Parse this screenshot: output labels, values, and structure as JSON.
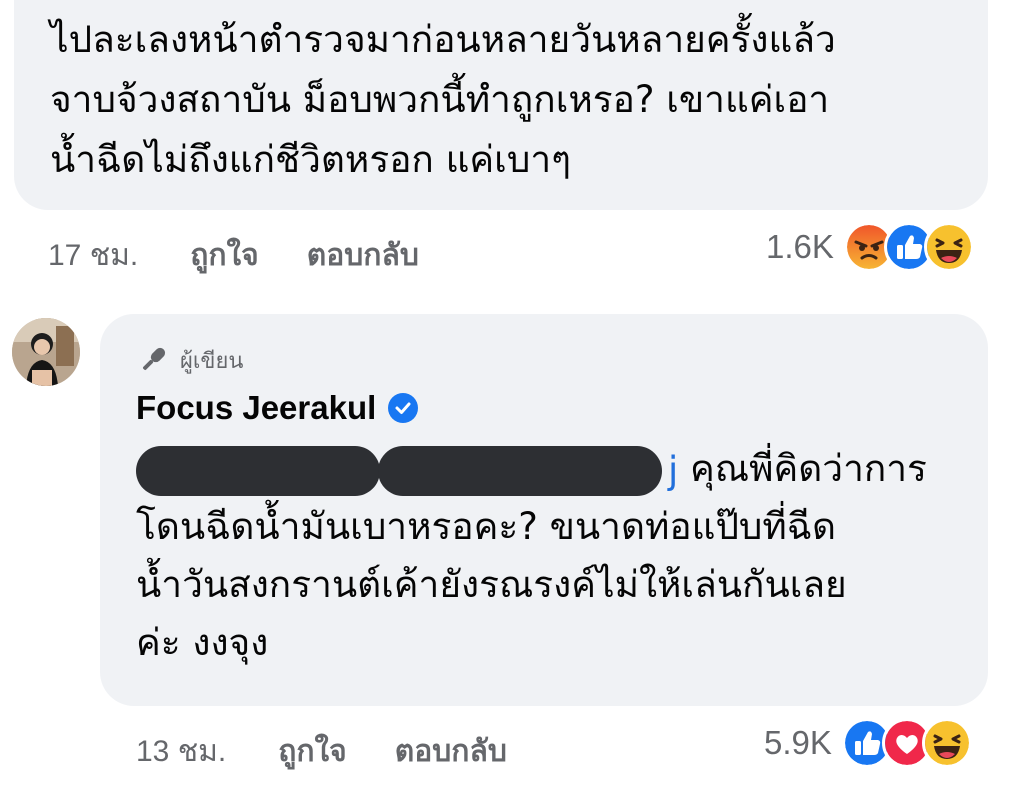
{
  "comment_1": {
    "text": "ไปละเลงหน้าตำรวจมาก่อนหลายวันหลายครั้งแล้ว\nจาบจ้วงสถาบัน ม็อบพวกนี้ทำถูกเหรอ? เขาแค่เอา\nน้ำฉีดไม่ถึงแก่ชีวิตหรอก แค่เบาๆ",
    "time": "17 ชม.",
    "like_label": "ถูกใจ",
    "reply_label": "ตอบกลับ",
    "reaction_count": "1.6K",
    "reaction_icons": [
      "angry-emoji",
      "like-emoji",
      "haha-emoji"
    ]
  },
  "comment_2": {
    "author_badge": "ผู้เขียน",
    "author_name": "Focus Jeerakul",
    "mention_tail": "j",
    "text_line_1": " คุณพี่คิดว่าการ",
    "text_rest": "โดนฉีดน้ำมันเบาหรอคะ? ขนาดท่อแป๊บที่ฉีด\nน้ำวันสงกรานต์เค้ายังรณรงค์ไม่ให้เล่นกันเลย\nค่ะ งงจุง",
    "time": "13 ชม.",
    "like_label": "ถูกใจ",
    "reply_label": "ตอบกลับ",
    "reaction_count": "5.9K",
    "reaction_icons": [
      "like-emoji",
      "love-emoji",
      "haha-emoji"
    ]
  },
  "colors": {
    "bubble_bg": "#f0f2f5",
    "meta_text": "#65676b",
    "facebook_blue": "#1877f2",
    "mention_blue": "#216fdb",
    "redaction": "#2d2f33"
  }
}
